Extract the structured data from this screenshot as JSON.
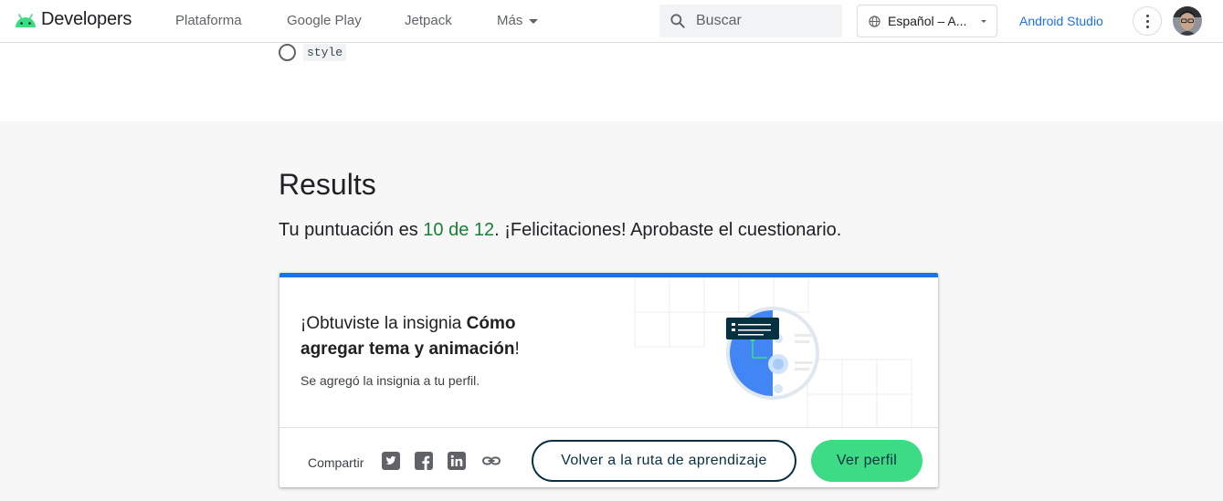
{
  "header": {
    "brand": "Developers",
    "nav": [
      "Plataforma",
      "Google Play",
      "Jetpack"
    ],
    "nav_more": "Más",
    "search_placeholder": "Buscar",
    "language": "Español – A...",
    "studio_link": "Android Studio",
    "colors": {
      "link": "#1a73e8",
      "android_green": "#3ddc84"
    }
  },
  "quiz": {
    "option_code": "style"
  },
  "results": {
    "title": "Results",
    "score_prefix": "Tu puntuación es ",
    "score": "10 de 12",
    "score_suffix": ". ¡Felicitaciones! Aprobaste el cuestionario.",
    "badge": {
      "heading_prefix": "¡Obtuviste la insignia ",
      "badge_name": "Cómo agregar tema y animación",
      "heading_suffix": "!",
      "subtext": "Se agregó la insignia a tu perfil."
    },
    "share_label": "Compartir",
    "share_icons": [
      "twitter-icon",
      "facebook-icon",
      "linkedin-icon",
      "link-icon"
    ],
    "back_button": "Volver a la ruta de aprendizaje",
    "profile_button": "Ver perfil"
  }
}
